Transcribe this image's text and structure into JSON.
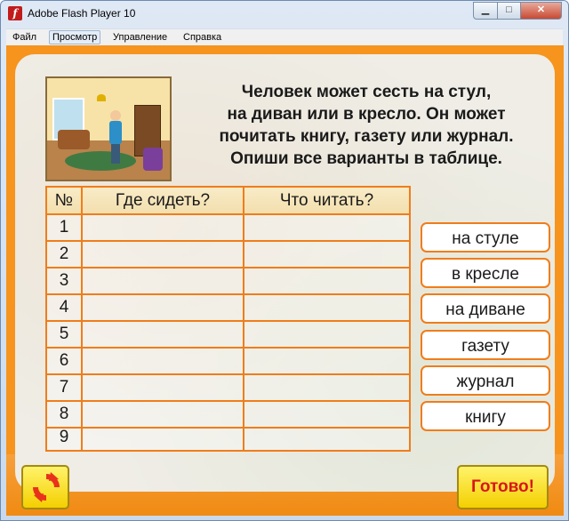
{
  "window": {
    "title": "Adobe Flash Player 10",
    "minimize_icon": "minimize-icon",
    "maximize_icon": "maximize-icon",
    "close_icon": "close-icon"
  },
  "menu": [
    "Файл",
    "Просмотр",
    "Управление",
    "Справка"
  ],
  "task_lines": [
    "Человек может сесть на стул,",
    "на диван или в кресло. Он может",
    "почитать книгу, газету или журнал.",
    "Опиши все варианты в таблице."
  ],
  "table": {
    "headers": [
      "№",
      "Где сидеть?",
      "Что читать?"
    ],
    "rows": [
      "1",
      "2",
      "3",
      "4",
      "5",
      "6",
      "7",
      "8",
      "9"
    ]
  },
  "words": [
    "на стуле",
    "в кресле",
    "на диване",
    "газету",
    "журнал",
    "книгу"
  ],
  "buttons": {
    "refresh_icon": "refresh-icon",
    "done_label": "Готово!"
  },
  "colors": {
    "accent": "#f6941e",
    "grid_line": "#f07d1a",
    "done_text": "#d8161b"
  }
}
